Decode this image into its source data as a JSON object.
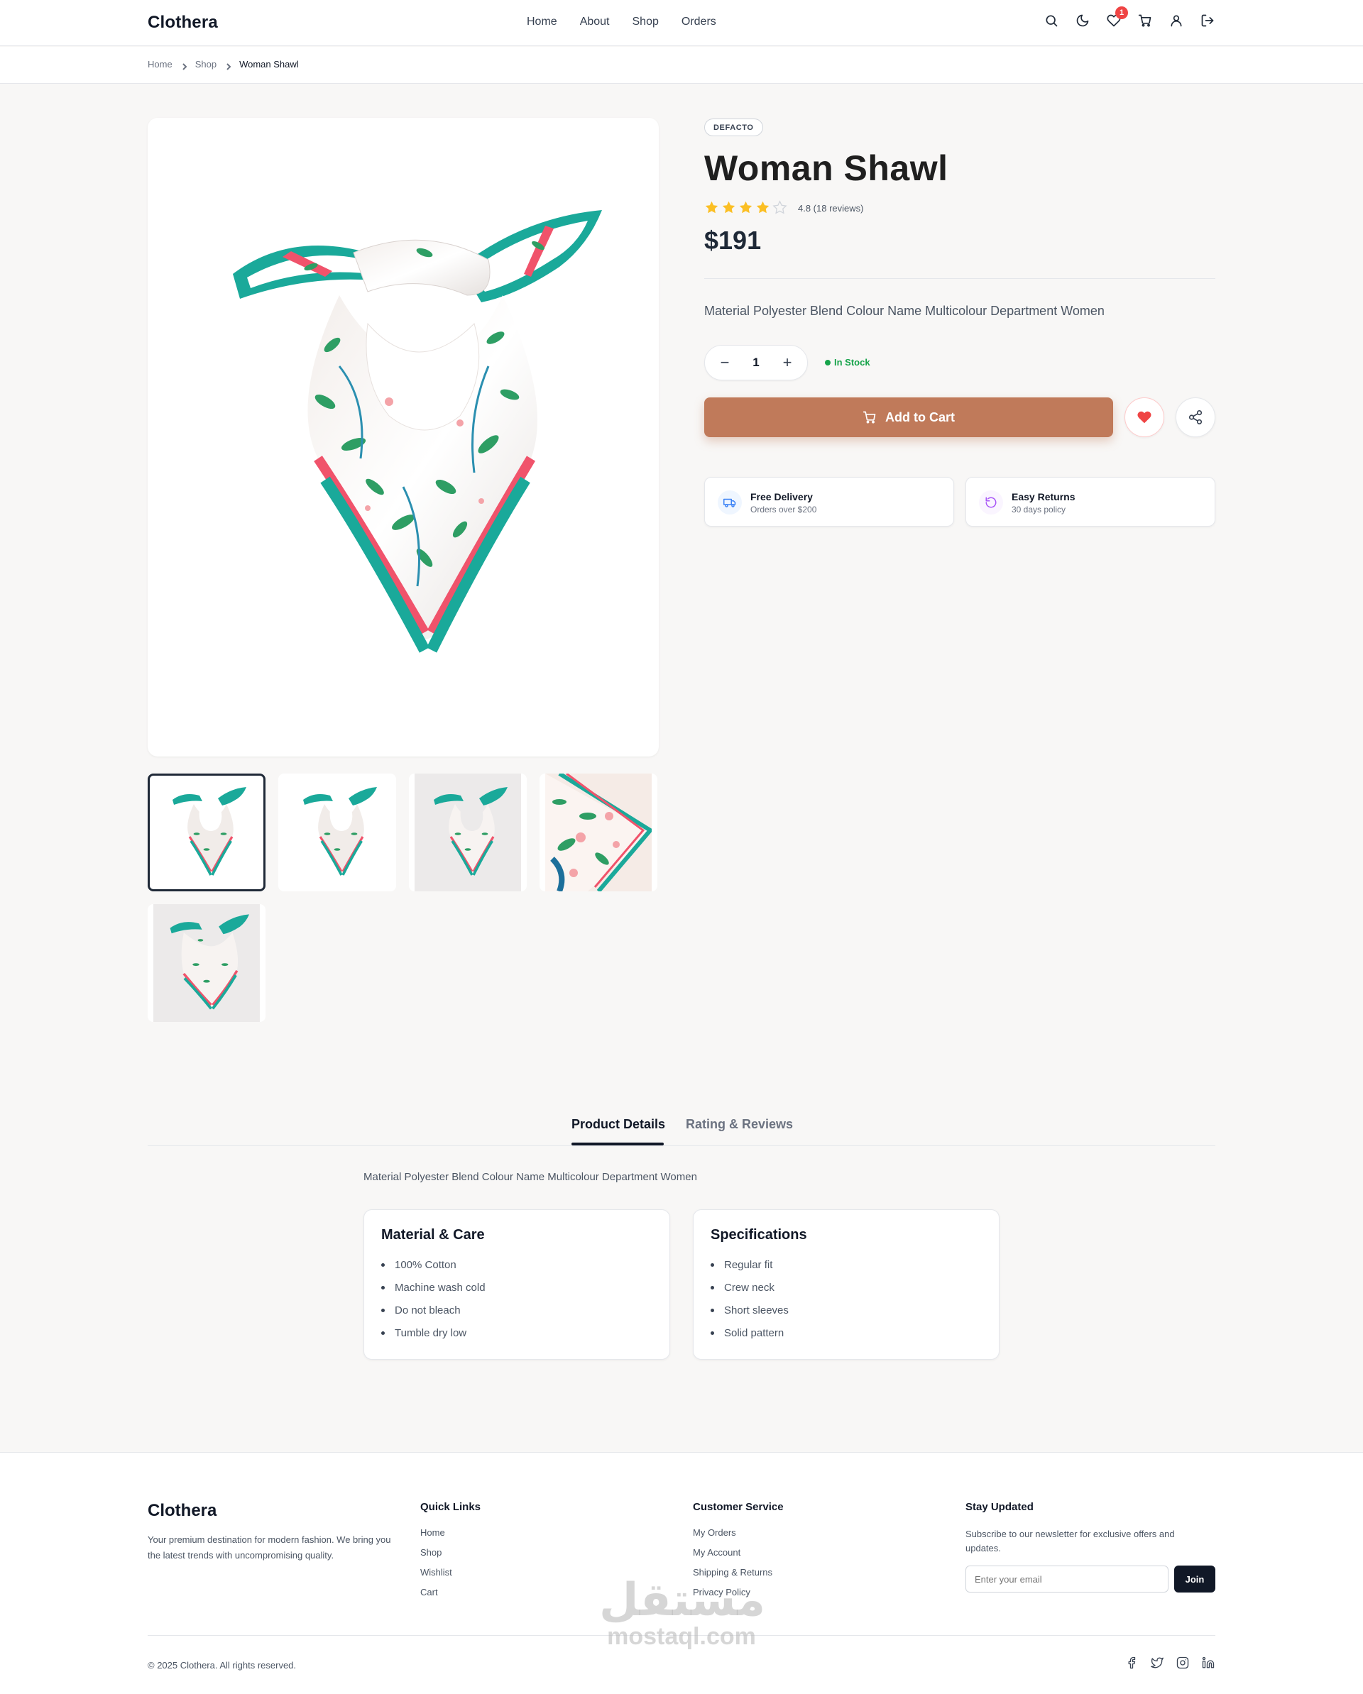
{
  "header": {
    "logo": "Clothera",
    "nav": [
      "Home",
      "About",
      "Shop",
      "Orders"
    ],
    "wishlist_count": "1",
    "icons": [
      "search-icon",
      "moon-icon",
      "heart-icon",
      "cart-icon",
      "user-icon",
      "logout-icon"
    ]
  },
  "breadcrumb": {
    "home": "Home",
    "shop": "Shop",
    "current": "Woman Shawl"
  },
  "product": {
    "brand": "DEFACTO",
    "title": "Woman Shawl",
    "rating": 4.8,
    "rating_text": "4.8 (18 reviews)",
    "stars_filled": 4,
    "price": "$191",
    "description": "Material Polyester Blend Colour Name Multicolour Department Women",
    "quantity": "1",
    "stock": "In Stock",
    "add_to_cart": "Add to Cart",
    "thumbnail_count": 5,
    "active_thumbnail": 1
  },
  "features": [
    {
      "title": "Free Delivery",
      "subtitle": "Orders over $200",
      "icon": "truck-icon"
    },
    {
      "title": "Easy Returns",
      "subtitle": "30 days policy",
      "icon": "refresh-icon"
    }
  ],
  "tabs": {
    "active": "Product Details",
    "inactive": "Rating & Reviews"
  },
  "details": {
    "description": "Material Polyester Blend Colour Name Multicolour Department Women",
    "material_title": "Material & Care",
    "material": [
      "100% Cotton",
      "Machine wash cold",
      "Do not bleach",
      "Tumble dry low"
    ],
    "spec_title": "Specifications",
    "specs": [
      "Regular fit",
      "Crew neck",
      "Short sleeves",
      "Solid pattern"
    ]
  },
  "footer": {
    "logo": "Clothera",
    "tagline": "Your premium destination for modern fashion. We bring you the latest trends with uncompromising quality.",
    "quick_links_title": "Quick Links",
    "quick_links": [
      "Home",
      "Shop",
      "Wishlist",
      "Cart"
    ],
    "service_title": "Customer Service",
    "service_links": [
      "My Orders",
      "My Account",
      "Shipping & Returns",
      "Privacy Policy"
    ],
    "news_title": "Stay Updated",
    "news_text": "Subscribe to our newsletter for exclusive offers and updates.",
    "email_placeholder": "Enter your email",
    "join": "Join",
    "copyright": "© 2025 Clothera. All rights reserved.",
    "social": [
      "facebook-icon",
      "twitter-icon",
      "instagram-icon",
      "linkedin-icon"
    ]
  },
  "watermark": {
    "arabic": "مستقل",
    "latin": "mostaql.com"
  },
  "colors": {
    "accent": "#c07a5a",
    "dark": "#111827",
    "star": "#fbbf24",
    "stock": "#16a34a",
    "badge": "#ef4444"
  }
}
